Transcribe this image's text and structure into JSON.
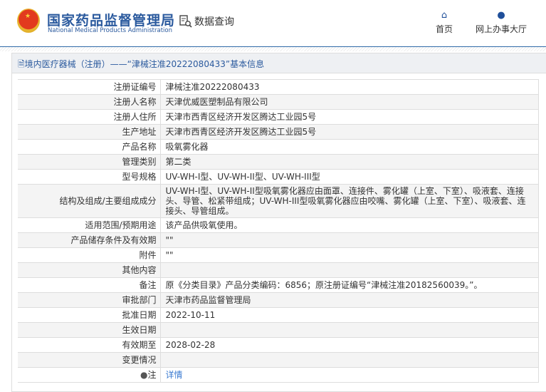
{
  "header": {
    "title_cn": "国家药品监督管理局",
    "title_en": "National Medical Products Administration",
    "query_label": "数据查询",
    "nav": [
      {
        "label": "首页",
        "icon": "home-icon"
      },
      {
        "label": "网上办事大厅",
        "icon": "user-icon"
      }
    ]
  },
  "panel": {
    "title": "境内医疗器械（注册）——“津械注准20222080433”基本信息"
  },
  "rows": [
    {
      "label": "注册证编号",
      "value": "津械注准20222080433"
    },
    {
      "label": "注册人名称",
      "value": "天津优威医塑制品有限公司"
    },
    {
      "label": "注册人住所",
      "value": "天津市西青区经济开发区腾达工业园5号"
    },
    {
      "label": "生产地址",
      "value": "天津市西青区经济开发区腾达工业园5号"
    },
    {
      "label": "产品名称",
      "value": "吸氧雾化器"
    },
    {
      "label": "管理类别",
      "value": "第二类"
    },
    {
      "label": "型号规格",
      "value": "UV-WH-I型、UV-WH-II型、UV-WH-III型"
    },
    {
      "label": "结构及组成/主要组成成分",
      "value": "UV-WH-I型、UV-WH-II型吸氧雾化器应由面罩、连接件、雾化罐（上室、下室）、吸液套、连接头、导管、松紧带组成；UV-WH-III型吸氧雾化器应由咬嘴、雾化罐（上室、下室）、吸液套、连接头、导管组成。"
    },
    {
      "label": "适用范围/预期用途",
      "value": "该产品供吸氧使用。"
    },
    {
      "label": "产品储存条件及有效期",
      "value": "\"\""
    },
    {
      "label": "附件",
      "value": "\"\""
    },
    {
      "label": "其他内容",
      "value": ""
    },
    {
      "label": "备注",
      "value": "原《分类目录》产品分类编码：6856；原注册证编号“津械注准20182560039。”。"
    },
    {
      "label": "审批部门",
      "value": "天津市药品监督管理局"
    },
    {
      "label": "批准日期",
      "value": "2022-10-11"
    },
    {
      "label": "生效日期",
      "value": ""
    },
    {
      "label": "有效期至",
      "value": "2028-02-28"
    },
    {
      "label": "变更情况",
      "value": ""
    }
  ],
  "note": {
    "label": "注",
    "link": "详情"
  }
}
